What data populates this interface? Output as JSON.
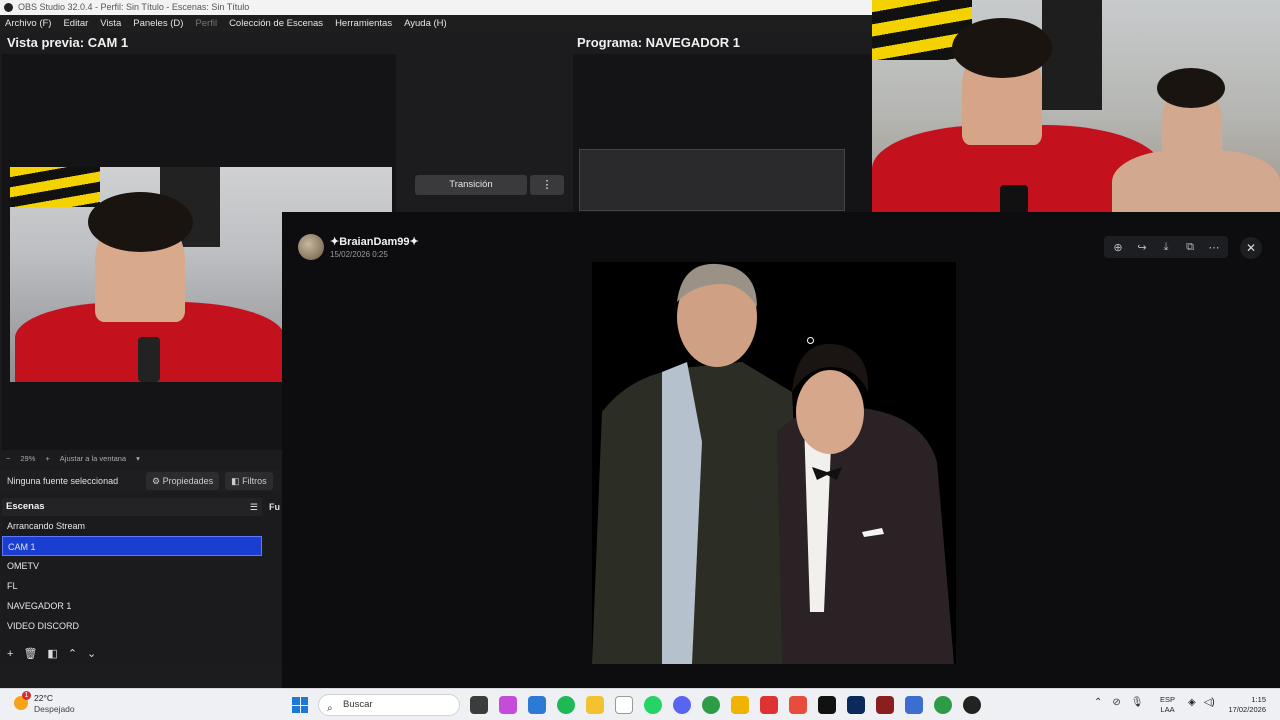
{
  "titlebar": {
    "title": "OBS Studio 32.0.4 - Perfil: Sin Título - Escenas: Sin Título"
  },
  "menu": {
    "archivo": "Archivo (F)",
    "editar": "Editar",
    "vista": "Vista",
    "paneles": "Paneles (D)",
    "perfil": "Perfil",
    "coleccion": "Colección de Escenas",
    "herramientas": "Herramientas",
    "ayuda": "Ayuda (H)"
  },
  "preview": {
    "title": "Vista previa: CAM 1",
    "zoom": "29%",
    "fit": "Ajustar a la ventana"
  },
  "program": {
    "title": "Programa: NAVEGADOR 1"
  },
  "transition": {
    "label": "Transición",
    "more": "⋮"
  },
  "source_bar": {
    "none_selected": "Ninguna fuente seleccionad",
    "properties": "Propiedades",
    "filters": "Filtros"
  },
  "scenes": {
    "header": "Escenas",
    "items": [
      "Arrancando Stream",
      "CAM 1",
      "OMETV",
      "FL",
      "NAVEGADOR 1",
      "VIDEO DISCORD"
    ],
    "selected_index": 1
  },
  "sources": {
    "header": "Fu"
  },
  "discord": {
    "author": "✦BraianDam99✦",
    "date": "15/02/2026 0:25",
    "toolbar_icons": [
      "zoom-in-icon",
      "forward-icon",
      "download-icon",
      "open-external-icon",
      "more-icon"
    ],
    "close": "✕"
  },
  "taskbar": {
    "temperature": "22°C",
    "weather": "Despejado",
    "alert_count": "1",
    "search_placeholder": "Buscar",
    "lang_top": "ESP",
    "lang_bottom": "LAA",
    "time": "1:15",
    "date": "17/02/2026"
  },
  "colors": {
    "accent": "#1a3fd0",
    "discord_bg": "#0d0d0f",
    "taskbar_bg": "#eef0f4"
  }
}
